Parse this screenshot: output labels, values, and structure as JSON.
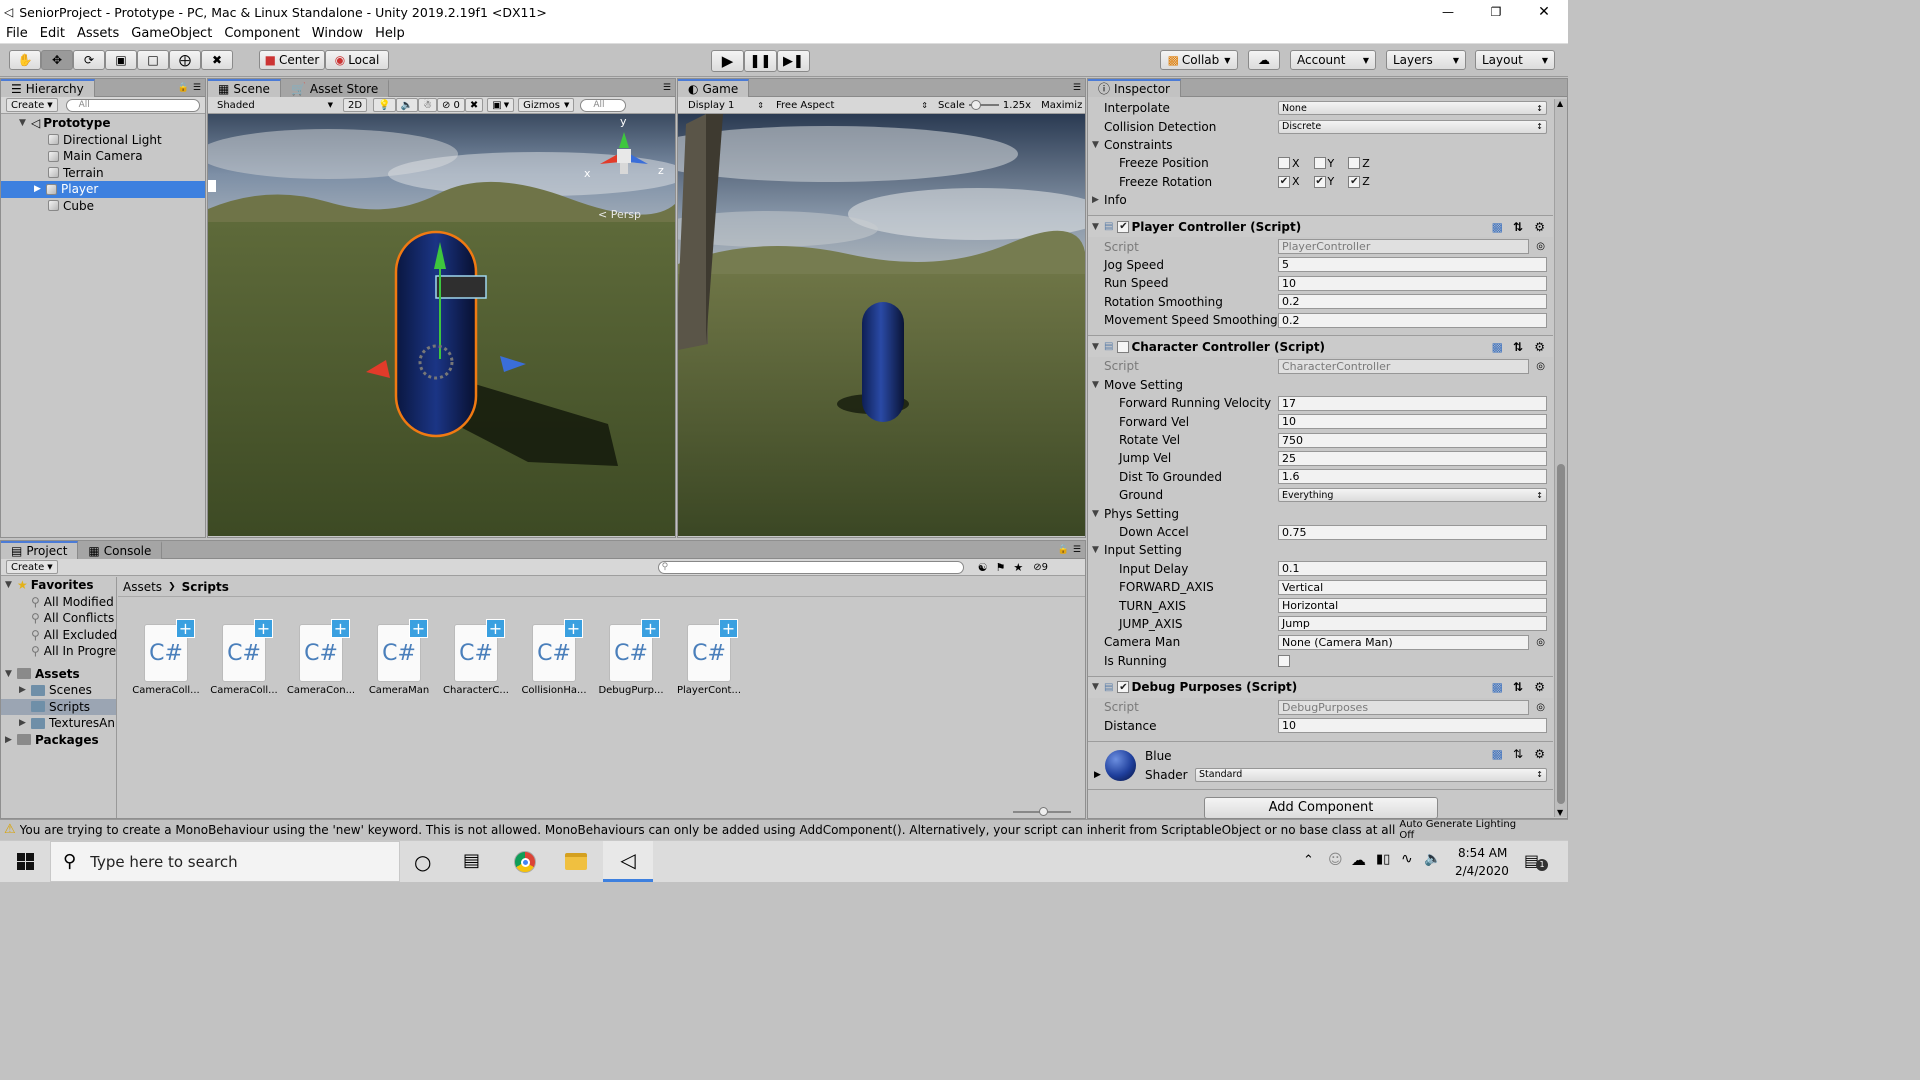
{
  "window": {
    "title": "SeniorProject - Prototype - PC, Mac & Linux Standalone - Unity 2019.2.19f1 <DX11>",
    "controls": [
      "—",
      "❐",
      "✕"
    ]
  },
  "menu": [
    "File",
    "Edit",
    "Assets",
    "GameObject",
    "Component",
    "Window",
    "Help"
  ],
  "toolbar": {
    "tools": [
      "hand-tool",
      "move-tool",
      "rotate-tool",
      "scale-tool",
      "rect-tool",
      "transform-tool",
      "custom-tool"
    ],
    "pivot": "Center",
    "space": "Local",
    "collab": "Collab",
    "account": "Account",
    "layers": "Layers",
    "layout": "Layout"
  },
  "hierarchy": {
    "tab": "Hierarchy",
    "create": "Create",
    "search_placeholder": "All",
    "scene": "Prototype",
    "items": [
      {
        "label": "Directional Light",
        "selected": false
      },
      {
        "label": "Main Camera",
        "selected": false
      },
      {
        "label": "Terrain",
        "selected": false
      },
      {
        "label": "Player",
        "selected": true
      },
      {
        "label": "Cube",
        "selected": false
      }
    ]
  },
  "scene": {
    "tabs": [
      "Scene",
      "Asset Store"
    ],
    "shading": "Shaded",
    "mode2d": "2D",
    "fx_count": "0",
    "gizmos": "Gizmos",
    "search_placeholder": "All",
    "persp": "Persp",
    "axis_labels": {
      "x": "x",
      "y": "y",
      "z": "z"
    }
  },
  "game": {
    "tab": "Game",
    "display": "Display 1",
    "aspect": "Free Aspect",
    "scale_label": "Scale",
    "scale_value": "1.25x",
    "maximize": "Maximiz"
  },
  "inspector": {
    "tab": "Inspector",
    "rigidbody": [
      {
        "label": "Interpolate",
        "value": "None"
      },
      {
        "label": "Collision Detection",
        "value": "Discrete"
      }
    ],
    "constraints": {
      "label": "Constraints",
      "freeze_position": {
        "label": "Freeze Position",
        "x": false,
        "y": false,
        "z": false
      },
      "freeze_rotation": {
        "label": "Freeze Rotation",
        "x": true,
        "y": true,
        "z": true
      },
      "axes": [
        "X",
        "Y",
        "Z"
      ]
    },
    "info": "Info",
    "player_controller": {
      "title": "Player Controller (Script)",
      "enabled": true,
      "script_label": "Script",
      "script": "PlayerController",
      "fields": [
        {
          "label": "Jog Speed",
          "value": "5"
        },
        {
          "label": "Run Speed",
          "value": "10"
        },
        {
          "label": "Rotation Smoothing",
          "value": "0.2"
        },
        {
          "label": "Movement Speed Smoothing",
          "value": "0.2"
        }
      ]
    },
    "character_controller": {
      "title": "Character Controller (Script)",
      "enabled": false,
      "script_label": "Script",
      "script": "CharacterController",
      "move_setting": {
        "label": "Move Setting",
        "fields": [
          {
            "label": "Forward Running Velocity",
            "value": "17"
          },
          {
            "label": "Forward Vel",
            "value": "10"
          },
          {
            "label": "Rotate Vel",
            "value": "750"
          },
          {
            "label": "Jump Vel",
            "value": "25"
          },
          {
            "label": "Dist To Grounded",
            "value": "1.6"
          }
        ],
        "ground_label": "Ground",
        "ground": "Everything"
      },
      "phys_setting": {
        "label": "Phys Setting",
        "fields": [
          {
            "label": "Down Accel",
            "value": "0.75"
          }
        ]
      },
      "input_setting": {
        "label": "Input Setting",
        "fields": [
          {
            "label": "Input Delay",
            "value": "0.1"
          },
          {
            "label": "FORWARD_AXIS",
            "value": "Vertical"
          },
          {
            "label": "TURN_AXIS",
            "value": "Horizontal"
          },
          {
            "label": "JUMP_AXIS",
            "value": "Jump"
          }
        ]
      },
      "camera_man": {
        "label": "Camera Man",
        "value": "None (Camera Man)"
      },
      "is_running": {
        "label": "Is Running",
        "value": false
      }
    },
    "debug_purposes": {
      "title": "Debug Purposes (Script)",
      "enabled": true,
      "script_label": "Script",
      "script": "DebugPurposes",
      "fields": [
        {
          "label": "Distance",
          "value": "10"
        }
      ]
    },
    "material": {
      "name": "Blue",
      "shader_label": "Shader",
      "shader": "Standard",
      "color": "#1f3f9c"
    },
    "add_component": "Add Component"
  },
  "project": {
    "tabs": [
      "Project",
      "Console"
    ],
    "create": "Create",
    "hidden_count": "9",
    "breadcrumb": [
      "Assets",
      "Scripts"
    ],
    "favorites": {
      "label": "Favorites",
      "items": [
        "All Modified",
        "All Conflicts",
        "All Excluded",
        "All In Progre"
      ]
    },
    "assets": {
      "label": "Assets",
      "items": [
        {
          "label": "Scenes",
          "selected": false
        },
        {
          "label": "Scripts",
          "selected": true
        },
        {
          "label": "TexturesAn",
          "selected": false
        }
      ]
    },
    "packages": "Packages",
    "files": [
      "CameraColl...",
      "CameraColl...",
      "CameraCon...",
      "CameraMan",
      "CharacterC...",
      "CollisionHa...",
      "DebugPurp...",
      "PlayerCont..."
    ],
    "file_badge": "C#"
  },
  "status": {
    "message": "You are trying to create a MonoBehaviour using the 'new' keyword.  This is not allowed.  MonoBehaviours can only be added using AddComponent(). Alternatively, your script can inherit from ScriptableObject or no base class at all",
    "right": "Auto Generate Lighting Off"
  },
  "taskbar": {
    "search_placeholder": "Type here to search",
    "time": "8:54 AM",
    "date": "2/4/2020",
    "notification_count": "1"
  },
  "colors": {
    "selection": "#3d80df",
    "accent": "#4b7bd6",
    "player_blue": "#1f3f9c"
  }
}
